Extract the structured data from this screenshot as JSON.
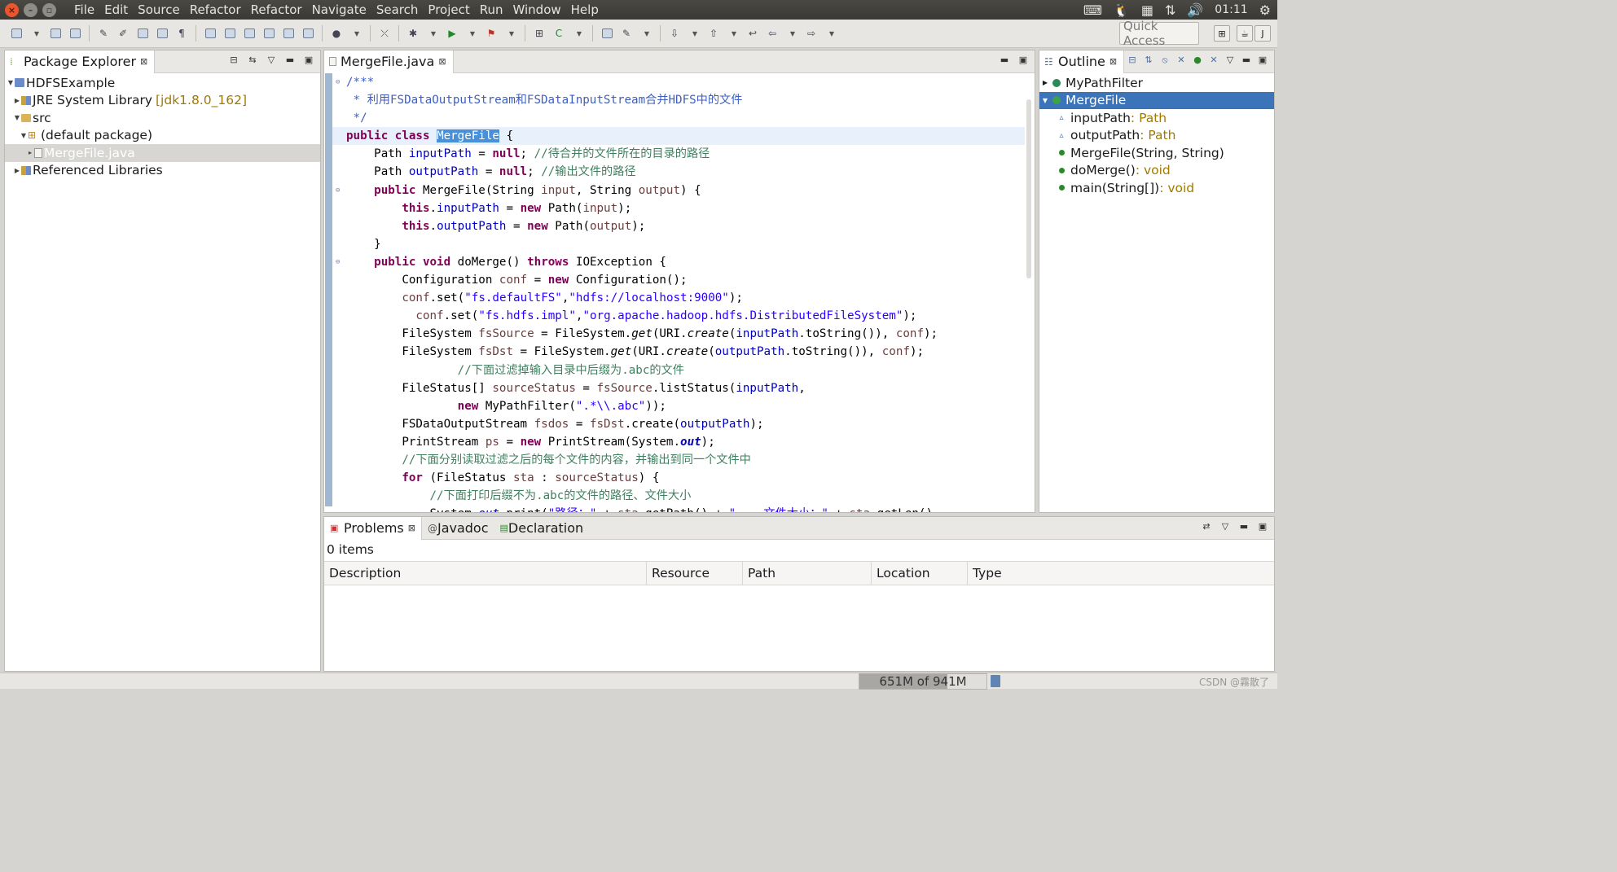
{
  "menubar": {
    "items": [
      "File",
      "Edit",
      "Source",
      "Refactor",
      "Refactor",
      "Navigate",
      "Search",
      "Project",
      "Run",
      "Window",
      "Help"
    ],
    "clock": "01:11"
  },
  "toolbar": {
    "quick_access": "Quick Access"
  },
  "package_explorer": {
    "title": "Package Explorer",
    "tree": [
      {
        "label": "HDFSExample",
        "decoration": "",
        "selected": false
      },
      {
        "label": "JRE System Library",
        "decoration": "[jdk1.8.0_162]",
        "selected": false
      },
      {
        "label": "src",
        "decoration": "",
        "selected": false
      },
      {
        "label": "(default package)",
        "decoration": "",
        "selected": false
      },
      {
        "label": "MergeFile.java",
        "decoration": "",
        "selected": true
      },
      {
        "label": "Referenced Libraries",
        "decoration": "",
        "selected": false
      }
    ]
  },
  "editor": {
    "tab_title": "MergeFile.java",
    "code_lines": [
      "/***",
      " * 利用FSDataOutputStream和FSDataInputStream合并HDFS中的文件",
      " */",
      "public class MergeFile {",
      "    Path inputPath = null; //待合并的文件所在的目录的路径",
      "    Path outputPath = null; //输出文件的路径",
      "    public MergeFile(String input, String output) {",
      "        this.inputPath = new Path(input);",
      "        this.outputPath = new Path(output);",
      "    }",
      "    public void doMerge() throws IOException {",
      "        Configuration conf = new Configuration();",
      "        conf.set(\"fs.defaultFS\",\"hdfs://localhost:9000\");",
      "          conf.set(\"fs.hdfs.impl\",\"org.apache.hadoop.hdfs.DistributedFileSystem\");",
      "        FileSystem fsSource = FileSystem.get(URI.create(inputPath.toString()), conf);",
      "        FileSystem fsDst = FileSystem.get(URI.create(outputPath.toString()), conf);",
      "                //下面过滤掉输入目录中后缀为.abc的文件",
      "        FileStatus[] sourceStatus = fsSource.listStatus(inputPath,",
      "                new MyPathFilter(\".*\\\\.abc\"));",
      "        FSDataOutputStream fsdos = fsDst.create(outputPath);",
      "        PrintStream ps = new PrintStream(System.out);",
      "        //下面分别读取过滤之后的每个文件的内容，并输出到同一个文件中",
      "        for (FileStatus sta : sourceStatus) {",
      "            //下面打印后缀不为.abc的文件的路径、文件大小",
      "            System.out.print(\"路径：\" + sta.getPath() + \"    文件大小：\" + sta.getLen()"
    ]
  },
  "outline": {
    "title": "Outline",
    "items": [
      {
        "label": "MyPathFilter",
        "type": ""
      },
      {
        "label": "MergeFile",
        "type": ""
      },
      {
        "label": "inputPath",
        "type": " : Path"
      },
      {
        "label": "outputPath",
        "type": " : Path"
      },
      {
        "label": "MergeFile(String, String)",
        "type": ""
      },
      {
        "label": "doMerge()",
        "type": " : void"
      },
      {
        "label": "main(String[])",
        "type": " : void"
      }
    ]
  },
  "problems": {
    "tabs": [
      "Problems",
      "Javadoc",
      "Declaration"
    ],
    "count": "0 items",
    "columns": [
      "Description",
      "Resource",
      "Path",
      "Location",
      "Type"
    ]
  },
  "status": {
    "heap": "651M of 941M",
    "heap_used_fraction": 0.69,
    "watermark": "CSDN @霧散了"
  },
  "colors": {
    "keyword": "#7f0055",
    "field": "#0000c0",
    "string": "#2a00ff",
    "comment": "#3f7f5f",
    "javadoc": "#3f5fbf",
    "selection": "#3b74b8"
  }
}
